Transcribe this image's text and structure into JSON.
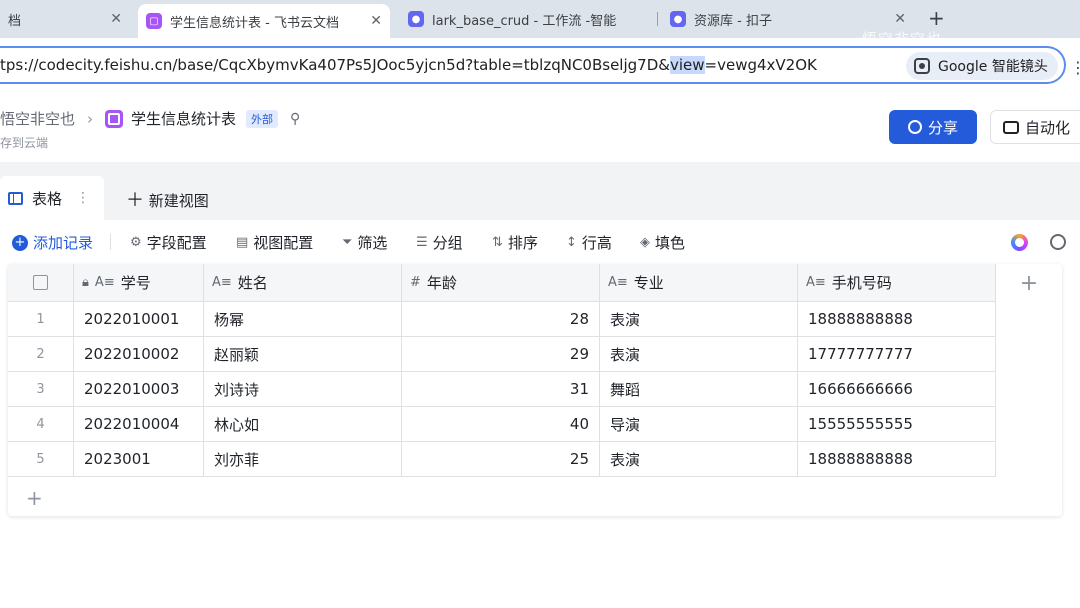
{
  "browser": {
    "tabs": [
      {
        "title": "档",
        "active": false
      },
      {
        "title": "学生信息统计表 - 飞书云文档",
        "active": true
      },
      {
        "title": "lark_base_crud - 工作流 -智能",
        "active": false
      },
      {
        "title": "资源库 - 扣子",
        "active": false
      }
    ],
    "watermark": "悟空非空也",
    "url": {
      "before": "tps://codecity.feishu.cn/base/CqcXbymvKa407Ps5JOoc5yjcn5d?table=tblzqNC0Bseljg7D&",
      "highlight": "view",
      "after": "=vewg4xV2OK"
    },
    "lens_label": "Google 智能镜头"
  },
  "header": {
    "workspace": "悟空非空也",
    "doc_title": "学生信息统计表",
    "badge": "外部",
    "saved_status": "存到云端",
    "share_label": "分享",
    "automation_label": "自动化"
  },
  "views": {
    "current": "表格",
    "new_view": "新建视图"
  },
  "toolbar": {
    "add_record": "添加记录",
    "field_config": "字段配置",
    "view_config": "视图配置",
    "filter": "筛选",
    "group": "分组",
    "sort": "排序",
    "row_height": "行高",
    "fill": "填色"
  },
  "table": {
    "columns": [
      {
        "label": "学号",
        "type_icon": "A≡"
      },
      {
        "label": "姓名",
        "type_icon": "A≡"
      },
      {
        "label": "年龄",
        "type_icon": "#"
      },
      {
        "label": "专业",
        "type_icon": "A≡"
      },
      {
        "label": "手机号码",
        "type_icon": "A≡"
      }
    ],
    "rows": [
      {
        "index": "1",
        "id": "2022010001",
        "name": "杨幂",
        "age": "28",
        "major": "表演",
        "phone": "18888888888"
      },
      {
        "index": "2",
        "id": "2022010002",
        "name": "赵丽颖",
        "age": "29",
        "major": "表演",
        "phone": "17777777777"
      },
      {
        "index": "3",
        "id": "2022010003",
        "name": "刘诗诗",
        "age": "31",
        "major": "舞蹈",
        "phone": "16666666666"
      },
      {
        "index": "4",
        "id": "2022010004",
        "name": "林心如",
        "age": "40",
        "major": "导演",
        "phone": "15555555555"
      },
      {
        "index": "5",
        "id": "2023001",
        "name": "刘亦菲",
        "age": "25",
        "major": "表演",
        "phone": "18888888888"
      }
    ]
  },
  "colors": {
    "accent": "#245bdb",
    "doc_icon": "#a855f7"
  }
}
